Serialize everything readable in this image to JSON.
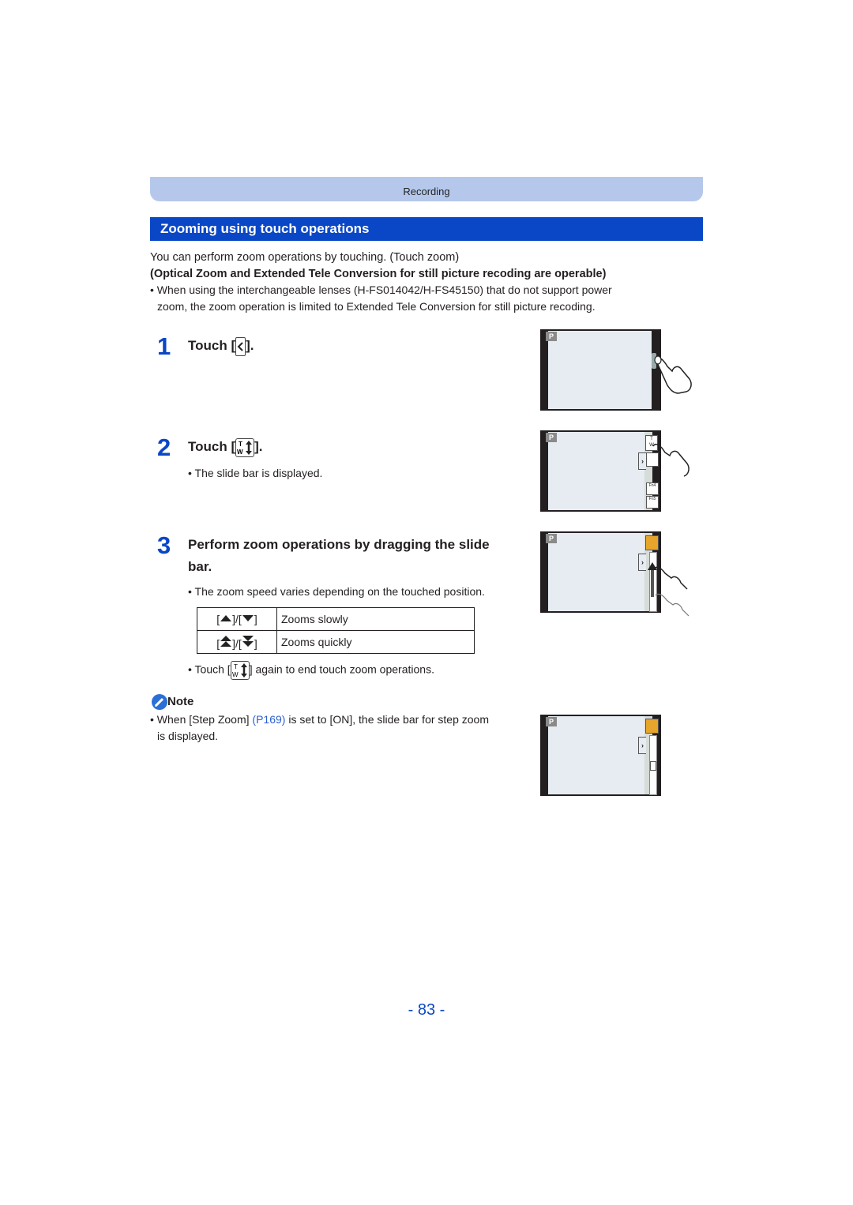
{
  "header": {
    "section_label": "Recording"
  },
  "section": {
    "title": "Zooming using touch operations"
  },
  "intro": {
    "text": "You can perform zoom operations by touching. (Touch zoom)",
    "bold_text": "(Optical Zoom and Extended Tele Conversion for still picture recoding are operable)",
    "bullet_line1": "When using the interchangeable lenses (H-FS014042/H-FS45150) that do not support power",
    "bullet_line2": "zoom, the zoom operation is limited to Extended Tele Conversion for still picture recoding."
  },
  "steps": [
    {
      "number": "1",
      "prefix": "Touch [",
      "suffix": "].",
      "icon": "tab-open-icon"
    },
    {
      "number": "2",
      "prefix": "Touch [",
      "suffix": "].",
      "icon": "tw-zoom-icon",
      "bullet": "The slide bar is displayed."
    },
    {
      "number": "3",
      "title_line1": "Perform zoom operations by dragging the slide",
      "title_line2": "bar.",
      "bullet": "The zoom speed varies depending on the touched position."
    }
  ],
  "zoom_table": {
    "rows": [
      {
        "keys": "[▲]/[▼]",
        "description": "Zooms slowly"
      },
      {
        "keys": "[⏶]/[⏷]",
        "description": "Zooms quickly"
      }
    ]
  },
  "end_bullet": {
    "prefix": "Touch [",
    "suffix": "] again to end touch zoom operations."
  },
  "note": {
    "label": "Note",
    "text_before": "When [Step Zoom] ",
    "link": "P169",
    "link_text": "(P169)",
    "text_after": " is set to [ON], the slide bar for step zoom",
    "text_line2": "is displayed."
  },
  "screens": {
    "mode_badge": "P",
    "fn4_label": "Fn4",
    "fn5_label": "Fn5"
  },
  "page_number": "- 83 -",
  "colors": {
    "accent_blue": "#0a47c6",
    "header_band": "#b5c8ec",
    "link": "#2b5fd0"
  }
}
